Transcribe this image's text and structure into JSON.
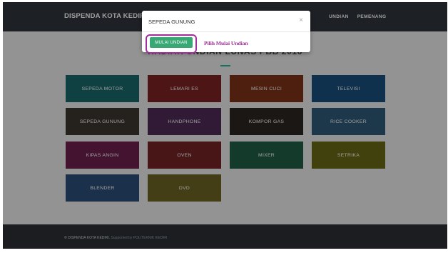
{
  "header": {
    "brand": "DISPENDA KOTA KEDIRI",
    "nav": [
      "UNDIAN",
      "PEMENANG"
    ]
  },
  "main": {
    "title": "HADIAH UNDIAN LUNAS PBB 2016"
  },
  "prizes": [
    {
      "label": "SEPEDA MOTOR",
      "color": "#1a6a6b"
    },
    {
      "label": "LEMARI ES",
      "color": "#7d2224"
    },
    {
      "label": "MESIN CUCI",
      "color": "#7e3119"
    },
    {
      "label": "TELEVISI",
      "color": "#1a4f7d"
    },
    {
      "label": "SEPEDA GUNUNG",
      "color": "#3c3630"
    },
    {
      "label": "HANDPHONE",
      "color": "#4f2a57"
    },
    {
      "label": "KOMPOR GAS",
      "color": "#2a2622"
    },
    {
      "label": "RICE COOKER",
      "color": "#2f5a7a"
    },
    {
      "label": "KIPAS ANGIN",
      "color": "#6e1f4c"
    },
    {
      "label": "OVEN",
      "color": "#762427"
    },
    {
      "label": "MIXER",
      "color": "#1f5e45"
    },
    {
      "label": "SETRIKA",
      "color": "#6a6a16"
    },
    {
      "label": "BLENDER",
      "color": "#2c4f7a"
    },
    {
      "label": "DVD",
      "color": "#6c6522"
    }
  ],
  "footer": {
    "copyright": "© DISPENDA KOTA KEDIRI.",
    "supported": " Supported by POLITEKNIK KEDIRI"
  },
  "modal": {
    "title": "SEPEDA GUNUNG",
    "close": "×",
    "start_button": "MULAI UNDIAN"
  },
  "annotation": "Pilih Mulai Undian",
  "colors": {
    "navbar": "#30343a",
    "accent": "#1abc9c",
    "highlight": "#a12e9c",
    "button": "#38a874"
  }
}
